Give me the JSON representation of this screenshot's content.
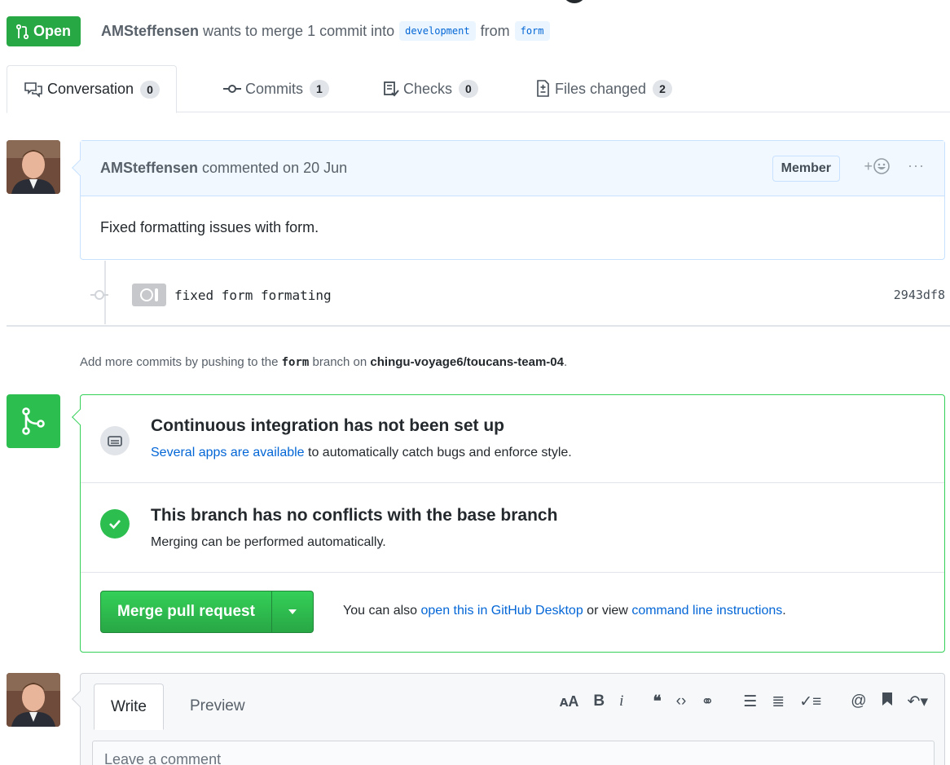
{
  "header": {
    "state_label": "Open",
    "author": "AMSteffensen",
    "merge_text": "wants to merge 1 commit into",
    "base_branch": "development",
    "from_text": "from",
    "head_branch": "form"
  },
  "tabs": [
    {
      "label": "Conversation",
      "count": "0"
    },
    {
      "label": "Commits",
      "count": "1"
    },
    {
      "label": "Checks",
      "count": "0"
    },
    {
      "label": "Files changed",
      "count": "2"
    }
  ],
  "comment": {
    "author": "AMSteffensen",
    "action": "commented on 20 Jun",
    "role_badge": "Member",
    "reaction_plus": "+",
    "more": "···",
    "body": "Fixed formatting issues with form."
  },
  "commit": {
    "message": "fixed form formating",
    "sha": "2943df8"
  },
  "push_note": {
    "prefix": "Add more commits by pushing to the",
    "branch": "form",
    "mid": "branch on",
    "repo": "chingu-voyage6/toucans-team-04",
    "suffix": "."
  },
  "merge_box": {
    "ci_title": "Continuous integration has not been set up",
    "ci_link": "Several apps are available",
    "ci_rest": "to automatically catch bugs and enforce style.",
    "conflict_title": "This branch has no conflicts with the base branch",
    "conflict_sub": "Merging can be performed automatically.",
    "merge_button": "Merge pull request",
    "alt_prefix": "You can also",
    "alt_link1": "open this in GitHub Desktop",
    "alt_mid": "or view",
    "alt_link2": "command line instructions",
    "alt_suffix": "."
  },
  "new_comment": {
    "tab_write": "Write",
    "tab_preview": "Preview",
    "placeholder": "Leave a comment"
  },
  "colors": {
    "green": "#28a745",
    "link_blue": "#0366d6",
    "comment_header_bg": "#f1f8ff"
  }
}
